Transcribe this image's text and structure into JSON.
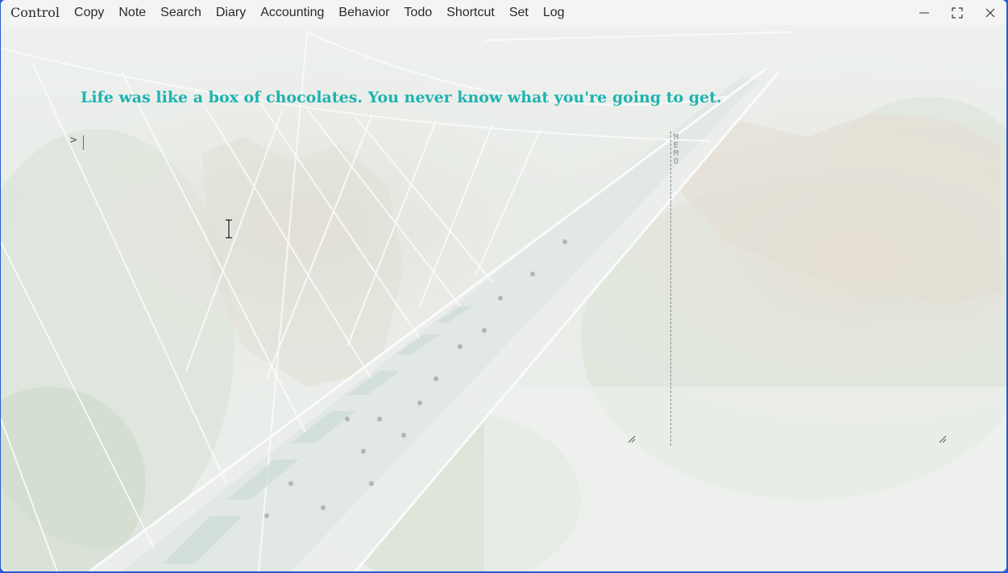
{
  "menu": {
    "items": [
      "Control",
      "Copy",
      "Note",
      "Search",
      "Diary",
      "Accounting",
      "Behavior",
      "Todo",
      "Shortcut",
      "Set",
      "Log"
    ]
  },
  "window_controls": {
    "minimize": "minimize-icon",
    "maximize": "maximize-icon",
    "close": "close-icon"
  },
  "main": {
    "quote": "Life was like a box of chocolates. You never know what you're going to get.",
    "prompt_symbol": ">",
    "input_value": ""
  },
  "memo": {
    "label": "MEMO",
    "letters": [
      "M",
      "E",
      "M",
      "O"
    ]
  },
  "colors": {
    "quote": "#1db3b0",
    "caret": "#d6336c"
  }
}
